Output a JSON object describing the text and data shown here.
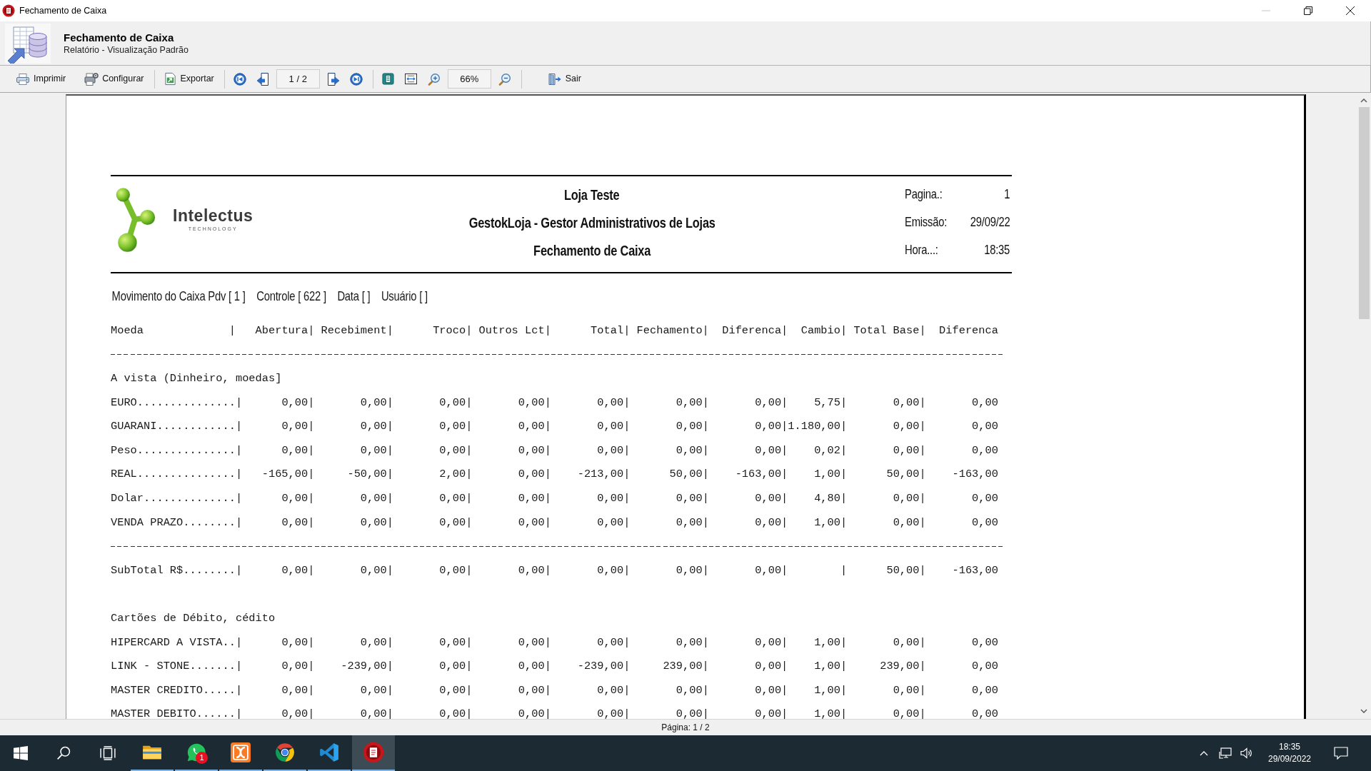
{
  "window": {
    "title": "Fechamento de Caixa",
    "controls": [
      {
        "kind": "minimize",
        "disabled": true
      },
      {
        "kind": "restore",
        "disabled": false
      },
      {
        "kind": "close",
        "disabled": false
      }
    ]
  },
  "header": {
    "title": "Fechamento de Caixa",
    "subtitle": "Relatório - Visualização Padrão"
  },
  "toolbar": {
    "groups": [
      [
        {
          "kind": "print",
          "label": "Imprimir"
        },
        {
          "kind": "setup",
          "label": "Configurar"
        }
      ],
      [
        {
          "kind": "export",
          "label": "Exportar"
        }
      ],
      [
        {
          "kind": "first"
        },
        {
          "kind": "previous"
        },
        {
          "kind": "pagefield",
          "value": "1 / 2"
        },
        {
          "kind": "next"
        },
        {
          "kind": "last"
        }
      ],
      [
        {
          "kind": "fitpage"
        },
        {
          "kind": "fitwidth"
        },
        {
          "kind": "zoomin"
        },
        {
          "kind": "zoomfield",
          "value": "66%"
        },
        {
          "kind": "zoomout"
        }
      ],
      [
        {
          "kind": "exit",
          "label": "Sair"
        }
      ]
    ]
  },
  "report": {
    "logo": {
      "name": "Intelectus",
      "tagline": "TECHNOLOGY"
    },
    "titles": [
      "Loja Teste",
      "GestokLoja - Gestor Administrativos de Lojas",
      "Fechamento de Caixa"
    ],
    "info": [
      {
        "label": "Pagina.:",
        "value": "1"
      },
      {
        "label": "Emissão:",
        "value": "29/09/22"
      },
      {
        "label": "Hora...:",
        "value": "18:35"
      }
    ],
    "filters": [
      "Movimento do Caixa Pdv [ 1 ]",
      "Controle [ 622 ]",
      "Data [ ]",
      "Usuário [ ]"
    ],
    "table": {
      "header": [
        "Moeda",
        "|",
        "Abertura|",
        "Recebiment|",
        "Troco|",
        "Outros Lct|",
        "Total|",
        "Fechamento|",
        "Diferenca|",
        "Cambio|",
        "Total Base|",
        "Diferenca"
      ],
      "sections": [
        {
          "title": "A vista (Dinheiro, moedas]",
          "rows": [
            [
              "EURO...............|",
              "0,00|",
              "0,00|",
              "0,00|",
              "0,00|",
              "0,00|",
              "0,00|",
              "0,00|",
              "5,75|",
              "0,00|",
              "0,00"
            ],
            [
              "GUARANI............|",
              "0,00|",
              "0,00|",
              "0,00|",
              "0,00|",
              "0,00|",
              "0,00|",
              "0,00|",
              "1.180,00|",
              "0,00|",
              "0,00"
            ],
            [
              "Peso...............|",
              "0,00|",
              "0,00|",
              "0,00|",
              "0,00|",
              "0,00|",
              "0,00|",
              "0,00|",
              "0,02|",
              "0,00|",
              "0,00"
            ],
            [
              "REAL...............|",
              "-165,00|",
              "-50,00|",
              "2,00|",
              "0,00|",
              "-213,00|",
              "50,00|",
              "-163,00|",
              "1,00|",
              "50,00|",
              "-163,00"
            ],
            [
              "Dolar..............|",
              "0,00|",
              "0,00|",
              "0,00|",
              "0,00|",
              "0,00|",
              "0,00|",
              "0,00|",
              "4,80|",
              "0,00|",
              "0,00"
            ],
            [
              "VENDA PRAZO........|",
              "0,00|",
              "0,00|",
              "0,00|",
              "0,00|",
              "0,00|",
              "0,00|",
              "0,00|",
              "1,00|",
              "0,00|",
              "0,00"
            ]
          ],
          "subtotal": [
            "SubTotal R$........|",
            "0,00|",
            "0,00|",
            "0,00|",
            "0,00|",
            "0,00|",
            "0,00|",
            "0,00|",
            "|",
            "50,00|",
            "-163,00"
          ]
        },
        {
          "title": "Cartões de Débito, cédito",
          "rows": [
            [
              "HIPERCARD A VISTA..|",
              "0,00|",
              "0,00|",
              "0,00|",
              "0,00|",
              "0,00|",
              "0,00|",
              "0,00|",
              "1,00|",
              "0,00|",
              "0,00"
            ],
            [
              "LINK - STONE.......|",
              "0,00|",
              "-239,00|",
              "0,00|",
              "0,00|",
              "-239,00|",
              "239,00|",
              "0,00|",
              "1,00|",
              "239,00|",
              "0,00"
            ],
            [
              "MASTER CREDITO.....|",
              "0,00|",
              "0,00|",
              "0,00|",
              "0,00|",
              "0,00|",
              "0,00|",
              "0,00|",
              "1,00|",
              "0,00|",
              "0,00"
            ],
            [
              "MASTER DEBITO......|",
              "0,00|",
              "0,00|",
              "0,00|",
              "0,00|",
              "0,00|",
              "0,00|",
              "0,00|",
              "1,00|",
              "0,00|",
              "0,00"
            ]
          ]
        }
      ]
    }
  },
  "status_bar": {
    "text": "Página: 1 / 2"
  },
  "taskbar": {
    "apps": [
      {
        "kind": "folder",
        "running": true,
        "selected": false
      },
      {
        "kind": "chat",
        "running": true,
        "selected": false,
        "badge": "1"
      },
      {
        "kind": "tile",
        "running": true,
        "selected": false
      },
      {
        "kind": "browser",
        "running": true,
        "selected": false
      },
      {
        "kind": "editor",
        "running": true,
        "selected": false
      },
      {
        "kind": "report",
        "running": true,
        "selected": true
      }
    ],
    "clock": {
      "time": "18:35",
      "date": "29/09/2022"
    }
  }
}
